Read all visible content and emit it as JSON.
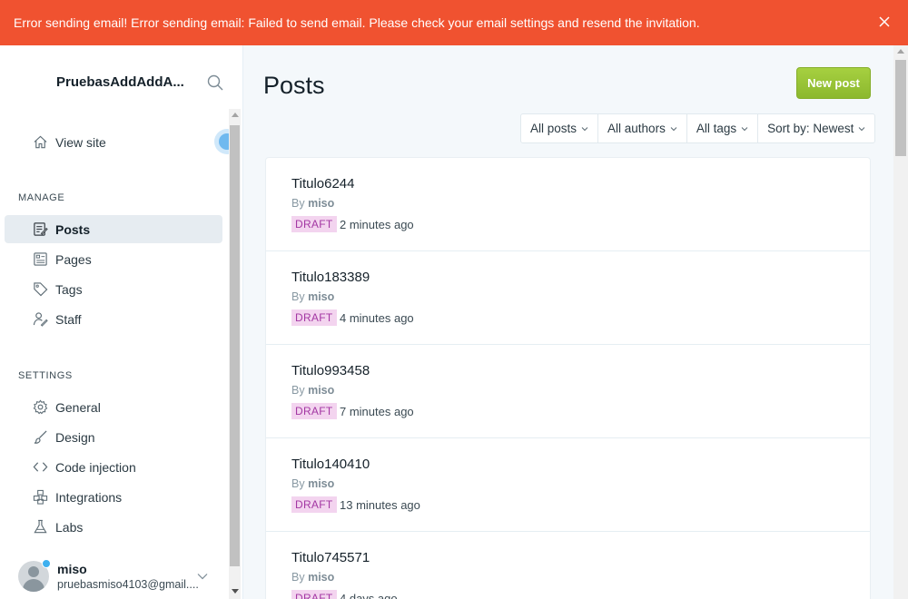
{
  "alert": {
    "message": "Error sending email! Error sending email: Failed to send email. Please check your email settings and resend the invitation.",
    "color": "#f05230",
    "close_icon": "close-icon"
  },
  "sidebar": {
    "site_title": "PruebasAddAddA...",
    "view_site": "View site",
    "manage_label": "MANAGE",
    "manage_items": [
      {
        "label": "Posts",
        "icon": "posts-icon",
        "active": true
      },
      {
        "label": "Pages",
        "icon": "pages-icon"
      },
      {
        "label": "Tags",
        "icon": "tag-icon"
      },
      {
        "label": "Staff",
        "icon": "staff-icon"
      }
    ],
    "settings_label": "SETTINGS",
    "settings_items": [
      {
        "label": "General",
        "icon": "gear-icon"
      },
      {
        "label": "Design",
        "icon": "brush-icon"
      },
      {
        "label": "Code injection",
        "icon": "code-icon"
      },
      {
        "label": "Integrations",
        "icon": "integrations-icon"
      },
      {
        "label": "Labs",
        "icon": "flask-icon"
      }
    ],
    "user": {
      "name": "miso",
      "email": "pruebasmiso4103@gmail...."
    }
  },
  "main": {
    "title": "Posts",
    "new_post_label": "New post",
    "filters": [
      "All posts",
      "All authors",
      "All tags",
      "Sort by: Newest"
    ],
    "posts": [
      {
        "title": "Titulo6244",
        "by": "By",
        "author": "miso",
        "status": "DRAFT",
        "time": "2 minutes ago"
      },
      {
        "title": "Titulo183389",
        "by": "By",
        "author": "miso",
        "status": "DRAFT",
        "time": "4 minutes ago"
      },
      {
        "title": "Titulo993458",
        "by": "By",
        "author": "miso",
        "status": "DRAFT",
        "time": "7 minutes ago"
      },
      {
        "title": "Titulo140410",
        "by": "By",
        "author": "miso",
        "status": "DRAFT",
        "time": "13 minutes ago"
      },
      {
        "title": "Titulo745571",
        "by": "By",
        "author": "miso",
        "status": "DRAFT",
        "time": "4 days ago"
      }
    ]
  },
  "colors": {
    "accent_green": "#9fc83a",
    "draft_bg": "#f3d4ef",
    "draft_text": "#a337a3"
  }
}
